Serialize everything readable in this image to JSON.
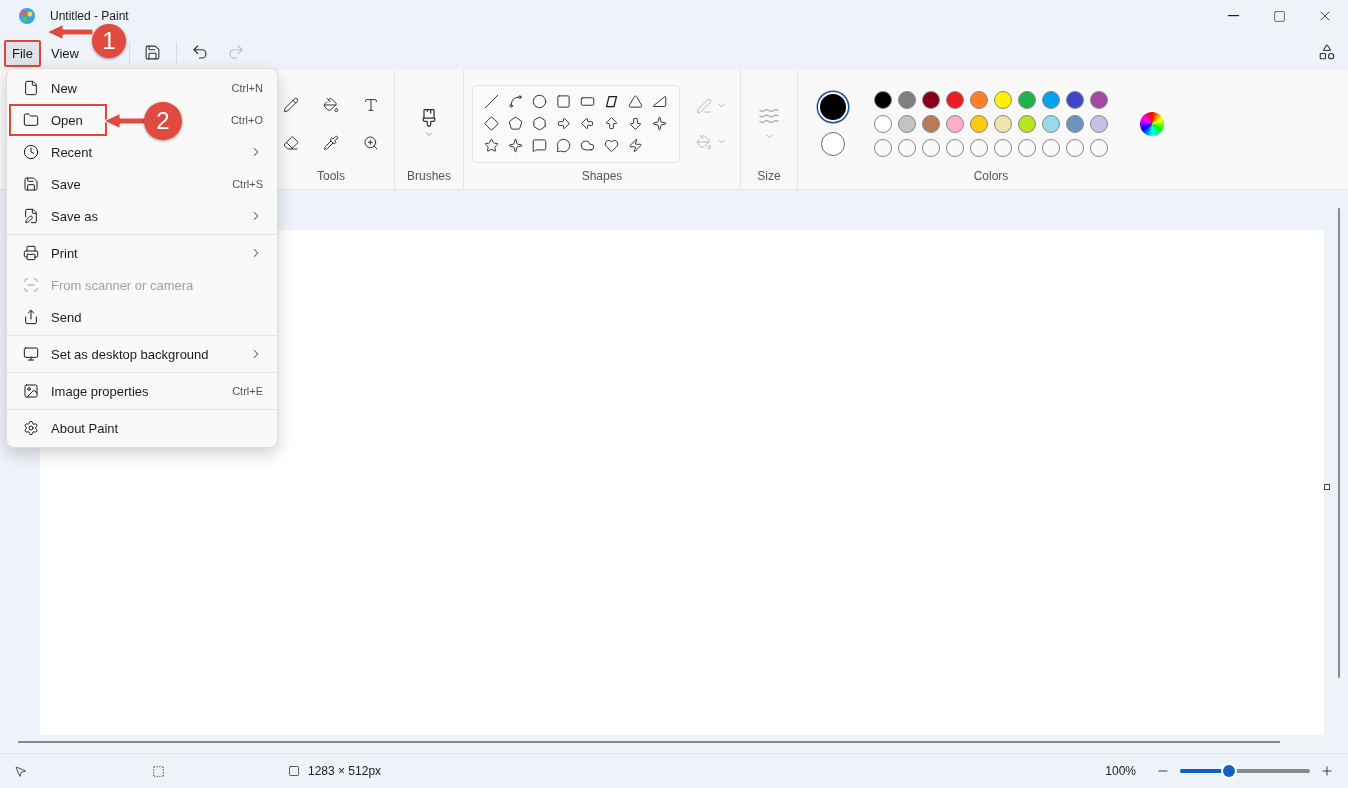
{
  "window": {
    "title": "Untitled - Paint"
  },
  "menu_bar": [
    {
      "label": "File",
      "selected": true,
      "highlighted": true
    },
    {
      "label": "View",
      "selected": false,
      "highlighted": false
    }
  ],
  "file_menu": [
    {
      "kind": "item",
      "label": "New",
      "shortcut": "Ctrl+N",
      "submenu": false,
      "disabled": false,
      "highlighted": false
    },
    {
      "kind": "item",
      "label": "Open",
      "shortcut": "Ctrl+O",
      "submenu": false,
      "disabled": false,
      "highlighted": true
    },
    {
      "kind": "item",
      "label": "Recent",
      "submenu": true,
      "disabled": false,
      "highlighted": false
    },
    {
      "kind": "item",
      "label": "Save",
      "shortcut": "Ctrl+S",
      "submenu": false,
      "disabled": false,
      "highlighted": false
    },
    {
      "kind": "item",
      "label": "Save as",
      "submenu": true,
      "disabled": false,
      "highlighted": false
    },
    {
      "kind": "separator"
    },
    {
      "kind": "item",
      "label": "Print",
      "submenu": true,
      "disabled": false,
      "highlighted": false
    },
    {
      "kind": "item",
      "label": "From scanner or camera",
      "submenu": false,
      "disabled": true,
      "highlighted": false
    },
    {
      "kind": "item",
      "label": "Send",
      "submenu": false,
      "disabled": false,
      "highlighted": false
    },
    {
      "kind": "separator"
    },
    {
      "kind": "item",
      "label": "Set as desktop background",
      "submenu": true,
      "disabled": false,
      "highlighted": false
    },
    {
      "kind": "separator"
    },
    {
      "kind": "item",
      "label": "Image properties",
      "shortcut": "Ctrl+E",
      "submenu": false,
      "disabled": false,
      "highlighted": false
    },
    {
      "kind": "separator"
    },
    {
      "kind": "item",
      "label": "About Paint",
      "submenu": false,
      "disabled": false,
      "highlighted": false
    }
  ],
  "ribbon": {
    "tools": {
      "label": "Tools"
    },
    "brushes": {
      "label": "Brushes"
    },
    "shapes": {
      "label": "Shapes"
    },
    "size": {
      "label": "Size"
    },
    "colors": {
      "label": "Colors",
      "primary": {
        "color": "#000000",
        "selected": true
      },
      "secondary": {
        "color": "#ffffff",
        "selected": false
      },
      "palette": [
        {
          "color": "#000000"
        },
        {
          "color": "#7f7f7f"
        },
        {
          "color": "#880015"
        },
        {
          "color": "#ed1c24"
        },
        {
          "color": "#ff7f27"
        },
        {
          "color": "#fff200"
        },
        {
          "color": "#22b14c"
        },
        {
          "color": "#00a2e8"
        },
        {
          "color": "#3f48cc"
        },
        {
          "color": "#a349a4"
        },
        {
          "color": "#ffffff"
        },
        {
          "color": "#c3c3c3"
        },
        {
          "color": "#b97a57"
        },
        {
          "color": "#ffaec9"
        },
        {
          "color": "#ffc90e"
        },
        {
          "color": "#efe4b0"
        },
        {
          "color": "#b5e61d"
        },
        {
          "color": "#99d9ea"
        },
        {
          "color": "#7092be"
        },
        {
          "color": "#c8bfe7"
        }
      ]
    }
  },
  "status_bar": {
    "canvas_size": "1283 × 512px",
    "zoom": "100%",
    "zoom_slider": {
      "level": 0.38
    }
  },
  "callouts": [
    {
      "label": "1"
    },
    {
      "label": "2"
    }
  ]
}
